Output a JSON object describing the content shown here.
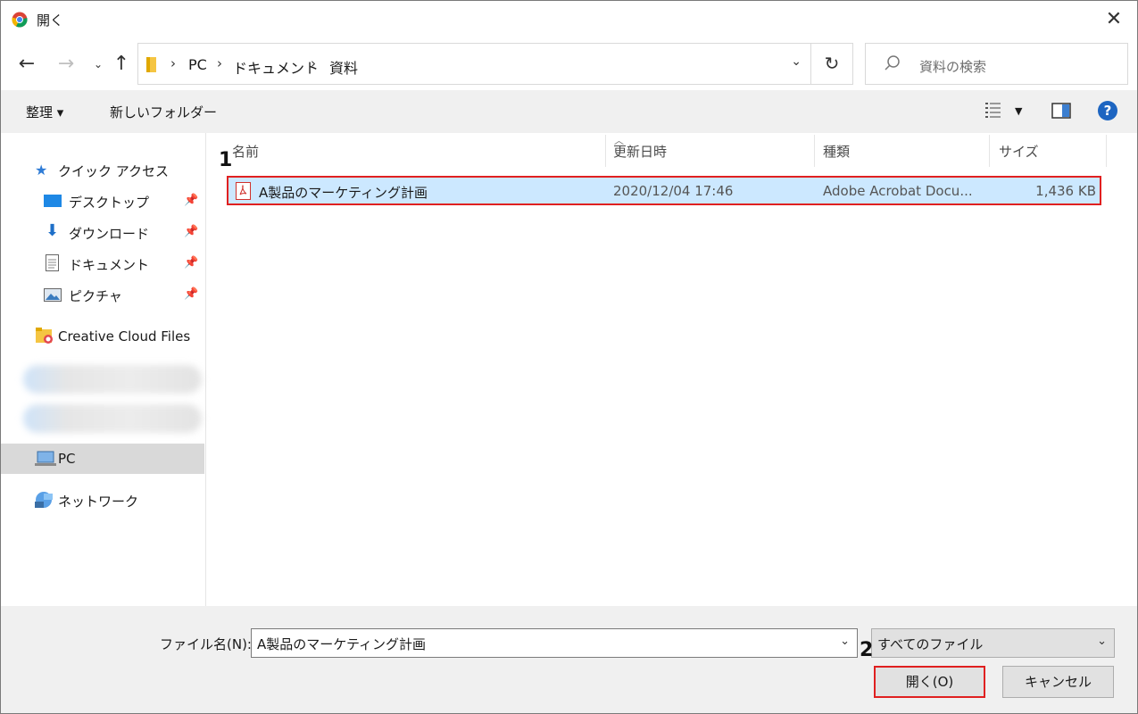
{
  "window": {
    "title": "開く"
  },
  "address": {
    "segments": [
      "PC",
      "ドキュメント",
      "資料"
    ]
  },
  "search": {
    "placeholder": "資料の検索"
  },
  "toolbar": {
    "organize": "整理 ▾",
    "new_folder": "新しいフォルダー",
    "help": "?"
  },
  "sidebar": {
    "quick_access": "クイック アクセス",
    "items": [
      "デスクトップ",
      "ダウンロード",
      "ドキュメント",
      "ピクチャ"
    ],
    "creative_cloud": "Creative Cloud Files",
    "pc": "PC",
    "network": "ネットワーク"
  },
  "columns": {
    "name": "名前",
    "modified": "更新日時",
    "type": "種類",
    "size": "サイズ"
  },
  "files": [
    {
      "name": "A製品のマーケティング計画",
      "modified": "2020/12/04 17:46",
      "type": "Adobe Acrobat Docu...",
      "size": "1,436 KB"
    }
  ],
  "markers": {
    "one": "1",
    "two": "2"
  },
  "footer": {
    "filename_label": "ファイル名(N):",
    "filename_value": "A製品のマーケティング計画",
    "filter_value": "すべてのファイル",
    "open_label": "開く(O)",
    "cancel_label": "キャンセル"
  }
}
